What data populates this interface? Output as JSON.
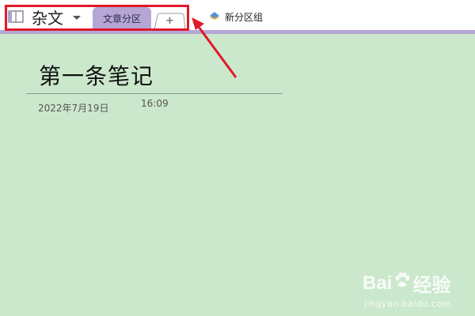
{
  "notebook": {
    "icon": "notebook-icon",
    "title": "杂文"
  },
  "tabs": {
    "active_label": "文章分区",
    "add_label": "+",
    "active_color": "#b5a6d6"
  },
  "section_group": {
    "icon": "section-group-icon",
    "label": "新分区组"
  },
  "page": {
    "title": "第一条笔记",
    "date": "2022年7月19日",
    "time": "16:09",
    "background": "#cbe8cc"
  },
  "annotation": {
    "color": "#e0192a"
  },
  "watermark": {
    "brand": "Bai",
    "brand_tail": "经验",
    "url": "jingyan.baidu.com"
  }
}
